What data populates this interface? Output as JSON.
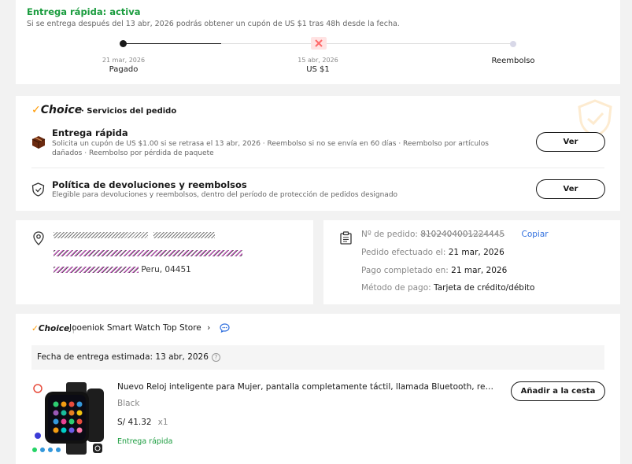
{
  "delivery": {
    "status_title": "Entrega rápida: activa",
    "status_note": "Si se entrega después del 13 abr, 2026 podrás obtener un cupón de US $1 tras 48h desde la fecha.",
    "steps": [
      {
        "date": "21 mar, 2026",
        "label": "Pagado"
      },
      {
        "date": "15 abr, 2026",
        "label": "US $1"
      },
      {
        "date": "",
        "label": "Reembolso"
      }
    ],
    "progress_step": 1,
    "colors": {
      "active": "#191919",
      "inactive": "#d8d8e8",
      "coupon": "#ff5c5c"
    }
  },
  "services": {
    "brand": "Choice",
    "heading": "· Servicios del pedido",
    "fast": {
      "title": "Entrega rápida",
      "desc": "Solicita un cupón de US $1.00 si se retrasa el 13 abr, 2026 · Reembolso si no se envía en 60 días · Reembolso por artículos dañados · Reembolso por pérdida de paquete",
      "button": "Ver"
    },
    "returns": {
      "title": "Política de devoluciones y reembolsos",
      "desc": "Elegible para devoluciones y reembolsos, dentro del período de protección de pedidos designado",
      "button": "Ver"
    }
  },
  "address": {
    "city_line": "Peru, 04451"
  },
  "order": {
    "number_label": "Nº de pedido:",
    "number_value": "8102404001224445",
    "copy": "Copiar",
    "placed_label": "Pedido efectuado el:",
    "placed_value": "21 mar, 2026",
    "paid_label": "Pago completado en:",
    "paid_value": "21 mar, 2026",
    "method_label": "Método de pago:",
    "method_value": "Tarjeta de crédito/débito"
  },
  "store": {
    "brand": "Choice",
    "name": "Jooeniok Smart Watch Top Store",
    "estimate": "Fecha de entrega estimada: 13 abr, 2026",
    "product": {
      "title": "Nuevo Reloj inteligente para Mujer, pantalla completamente táctil, llamada Bluetooth, relojes inteligentes",
      "variant": "Black",
      "price": "S/ 41.32",
      "qty": "x1",
      "fast": "Entrega rápida",
      "cart_button": "Añadir a la cesta"
    }
  }
}
